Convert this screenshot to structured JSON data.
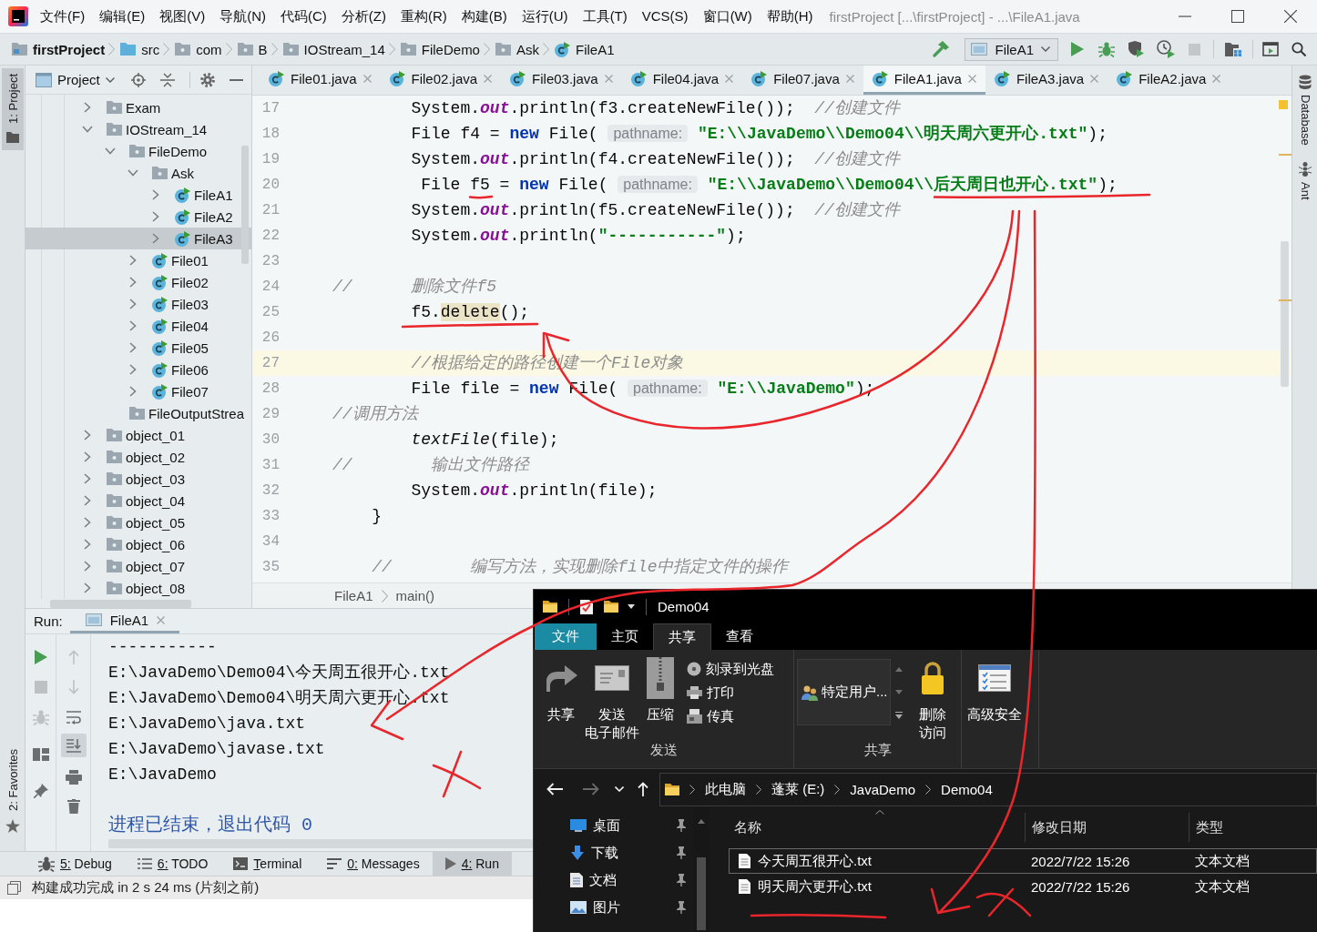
{
  "title_bar": {
    "menus": [
      "文件(F)",
      "编辑(E)",
      "视图(V)",
      "导航(N)",
      "代码(C)",
      "分析(Z)",
      "重构(R)",
      "构建(B)",
      "运行(U)",
      "工具(T)",
      "VCS(S)",
      "窗口(W)",
      "帮助(H)"
    ],
    "title": "firstProject [...\\firstProject] - ...\\FileA1.java"
  },
  "navigation_bar": {
    "breadcrumbs": [
      {
        "label": "firstProject",
        "kind": "project"
      },
      {
        "label": "src",
        "kind": "source"
      },
      {
        "label": "com",
        "kind": "package"
      },
      {
        "label": "B",
        "kind": "package"
      },
      {
        "label": "IOStream_14",
        "kind": "package"
      },
      {
        "label": "FileDemo",
        "kind": "package"
      },
      {
        "label": "Ask",
        "kind": "package"
      },
      {
        "label": "FileA1",
        "kind": "class"
      }
    ],
    "run_config": "FileA1",
    "tools": [
      {
        "disabled": false
      },
      {
        "disabled": false
      },
      {
        "disabled": false
      },
      {
        "disabled": false
      },
      {
        "disabled": true
      }
    ]
  },
  "left_strip": [
    {
      "label": "1: Project",
      "selected": true
    },
    {
      "label": "2: Favorites",
      "selected": false
    }
  ],
  "project_panel": {
    "title": "Project",
    "tree": [
      {
        "label": "Exam",
        "kind": "package",
        "expandable": true,
        "expanded": false,
        "selected": false
      },
      {
        "label": "IOStream_14",
        "kind": "package",
        "expandable": true,
        "expanded": true,
        "selected": false,
        "children": [
          {
            "label": "FileDemo",
            "kind": "package",
            "expandable": true,
            "expanded": true,
            "selected": false,
            "children": [
              {
                "label": "Ask",
                "kind": "package",
                "expandable": true,
                "expanded": true,
                "selected": false,
                "children": [
                  {
                    "label": "FileA1",
                    "kind": "class",
                    "expandable": true,
                    "expanded": false,
                    "selected": false
                  },
                  {
                    "label": "FileA2",
                    "kind": "class",
                    "expandable": true,
                    "expanded": false,
                    "selected": false
                  },
                  {
                    "label": "FileA3",
                    "kind": "class",
                    "expandable": true,
                    "expanded": false,
                    "selected": true
                  }
                ]
              },
              {
                "label": "File01",
                "kind": "class",
                "expandable": true,
                "expanded": false,
                "selected": false
              },
              {
                "label": "File02",
                "kind": "class",
                "expandable": true,
                "expanded": false,
                "selected": false
              },
              {
                "label": "File03",
                "kind": "class",
                "expandable": true,
                "expanded": false,
                "selected": false
              },
              {
                "label": "File04",
                "kind": "class",
                "expandable": true,
                "expanded": false,
                "selected": false
              },
              {
                "label": "File05",
                "kind": "class",
                "expandable": true,
                "expanded": false,
                "selected": false
              },
              {
                "label": "File06",
                "kind": "class",
                "expandable": true,
                "expanded": false,
                "selected": false
              },
              {
                "label": "File07",
                "kind": "class",
                "expandable": true,
                "expanded": false,
                "selected": false
              }
            ]
          },
          {
            "label": "FileOutputStrea",
            "kind": "package",
            "expandable": false,
            "selected": false
          }
        ]
      },
      {
        "label": "object_01",
        "kind": "package",
        "expandable": true,
        "expanded": false,
        "selected": false
      },
      {
        "label": "object_02",
        "kind": "package",
        "expandable": true,
        "expanded": false,
        "selected": false
      },
      {
        "label": "object_03",
        "kind": "package",
        "expandable": true,
        "expanded": false,
        "selected": false
      },
      {
        "label": "object_04",
        "kind": "package",
        "expandable": true,
        "expanded": false,
        "selected": false
      },
      {
        "label": "object_05",
        "kind": "package",
        "expandable": true,
        "expanded": false,
        "selected": false
      },
      {
        "label": "object_06",
        "kind": "package",
        "expandable": true,
        "expanded": false,
        "selected": false
      },
      {
        "label": "object_07",
        "kind": "package",
        "expandable": true,
        "expanded": false,
        "selected": false
      },
      {
        "label": "object_08",
        "kind": "package",
        "expandable": true,
        "expanded": false,
        "selected": false
      }
    ]
  },
  "editor": {
    "tabs": [
      {
        "label": "File01.java",
        "selected": false
      },
      {
        "label": "File02.java",
        "selected": false
      },
      {
        "label": "File03.java",
        "selected": false
      },
      {
        "label": "File04.java",
        "selected": false
      },
      {
        "label": "File07.java",
        "selected": false
      },
      {
        "label": "FileA1.java",
        "selected": true
      },
      {
        "label": "FileA3.java",
        "selected": false
      },
      {
        "label": "FileA2.java",
        "selected": false
      }
    ],
    "lines": [
      {
        "number": "17",
        "current": false,
        "tokens": [
          {
            "kind": "plain",
            "text": "        System."
          },
          {
            "kind": "field",
            "text": "out"
          },
          {
            "kind": "plain",
            "text": ".println(f3.createNewFile());  "
          },
          {
            "kind": "comment",
            "text": "//创建文件"
          }
        ]
      },
      {
        "number": "18",
        "current": false,
        "tokens": [
          {
            "kind": "plain",
            "text": "        File f4 = "
          },
          {
            "kind": "keyword",
            "text": "new"
          },
          {
            "kind": "plain",
            "text": " File( "
          },
          {
            "kind": "hint",
            "text": "pathname:"
          },
          {
            "kind": "string",
            "text": " \"E:\\\\JavaDemo\\\\Demo04\\\\明天周六更开心.txt\""
          },
          {
            "kind": "plain",
            "text": ");"
          }
        ]
      },
      {
        "number": "19",
        "current": false,
        "tokens": [
          {
            "kind": "plain",
            "text": "        System."
          },
          {
            "kind": "field",
            "text": "out"
          },
          {
            "kind": "plain",
            "text": ".println(f4.createNewFile());  "
          },
          {
            "kind": "comment",
            "text": "//创建文件"
          }
        ]
      },
      {
        "number": "20",
        "current": false,
        "tokens": [
          {
            "kind": "plain",
            "text": "         File f5 = "
          },
          {
            "kind": "keyword",
            "text": "new"
          },
          {
            "kind": "plain",
            "text": " File( "
          },
          {
            "kind": "hint",
            "text": "pathname:"
          },
          {
            "kind": "string",
            "text": " \"E:\\\\JavaDemo\\\\Demo04\\\\后天周日也开心.txt\""
          },
          {
            "kind": "plain",
            "text": ");"
          }
        ]
      },
      {
        "number": "21",
        "current": false,
        "tokens": [
          {
            "kind": "plain",
            "text": "        System."
          },
          {
            "kind": "field",
            "text": "out"
          },
          {
            "kind": "plain",
            "text": ".println(f5.createNewFile());  "
          },
          {
            "kind": "comment",
            "text": "//创建文件"
          }
        ]
      },
      {
        "number": "22",
        "current": false,
        "tokens": [
          {
            "kind": "plain",
            "text": "        System."
          },
          {
            "kind": "field",
            "text": "out"
          },
          {
            "kind": "plain",
            "text": ".println("
          },
          {
            "kind": "string",
            "text": "\"-----------\""
          },
          {
            "kind": "plain",
            "text": ");"
          }
        ]
      },
      {
        "number": "23",
        "current": false
      },
      {
        "number": "24",
        "current": false,
        "tokens": [
          {
            "kind": "comment",
            "text": "//      删除文件f5"
          }
        ]
      },
      {
        "number": "25",
        "current": false,
        "tokens": [
          {
            "kind": "plain",
            "text": "        f5."
          },
          {
            "kind": "usage",
            "text": "delete"
          },
          {
            "kind": "plain",
            "text": "();"
          }
        ]
      },
      {
        "number": "26",
        "current": false
      },
      {
        "number": "27",
        "current": true,
        "tokens": [
          {
            "kind": "comment",
            "text": "        //根据给定的路径创建一个File对象"
          }
        ]
      },
      {
        "number": "28",
        "current": false,
        "tokens": [
          {
            "kind": "plain",
            "text": "        File file = "
          },
          {
            "kind": "keyword",
            "text": "new"
          },
          {
            "kind": "plain",
            "text": " File( "
          },
          {
            "kind": "hint",
            "text": "pathname:"
          },
          {
            "kind": "string",
            "text": " \"E:\\\\JavaDemo\""
          },
          {
            "kind": "plain",
            "text": ");"
          }
        ]
      },
      {
        "number": "29",
        "current": false,
        "tokens": [
          {
            "kind": "comment",
            "text": "//调用方法"
          }
        ]
      },
      {
        "number": "30",
        "current": false,
        "tokens": [
          {
            "kind": "static",
            "text": "        textFile"
          },
          {
            "kind": "plain",
            "text": "(file);"
          }
        ]
      },
      {
        "number": "31",
        "current": false,
        "tokens": [
          {
            "kind": "comment",
            "text": "//        输出文件路径"
          }
        ]
      },
      {
        "number": "32",
        "current": false,
        "tokens": [
          {
            "kind": "plain",
            "text": "        System."
          },
          {
            "kind": "field",
            "text": "out"
          },
          {
            "kind": "plain",
            "text": ".println(file);"
          }
        ]
      },
      {
        "number": "33",
        "current": false,
        "tokens": [
          {
            "kind": "plain",
            "text": "    }"
          }
        ]
      },
      {
        "number": "34",
        "current": false
      },
      {
        "number": "35",
        "current": false,
        "tokens": [
          {
            "kind": "comment",
            "text": "    //        编写方法，实现删除file中指定文件的操作"
          }
        ]
      }
    ],
    "breadcrumb": [
      "FileA1",
      "main()"
    ]
  },
  "right_strip": [
    "Database",
    "Ant"
  ],
  "run_panel": {
    "label": "Run:",
    "tabs": [
      {
        "label": "FileA1",
        "selected": true
      }
    ],
    "actions": [
      {
        "disabled": false,
        "on": false
      },
      {
        "disabled": true,
        "on": false
      },
      {
        "disabled": true,
        "on": false
      },
      {
        "disabled": false,
        "on": false
      },
      {
        "disabled": false,
        "on": false
      },
      {
        "disabled": true,
        "on": false
      },
      {
        "disabled": true,
        "on": false
      },
      {
        "disabled": false,
        "on": false
      },
      {
        "disabled": false,
        "on": true
      },
      {
        "disabled": false,
        "on": false
      },
      {
        "disabled": false,
        "on": false
      }
    ],
    "output": [
      {
        "kind": "plain",
        "text": "-----------"
      },
      {
        "kind": "plain",
        "text": "E:\\JavaDemo\\Demo04\\今天周五很开心.txt"
      },
      {
        "kind": "plain",
        "text": "E:\\JavaDemo\\Demo04\\明天周六更开心.txt"
      },
      {
        "kind": "plain",
        "text": "E:\\JavaDemo\\java.txt"
      },
      {
        "kind": "plain",
        "text": "E:\\JavaDemo\\javase.txt"
      },
      {
        "kind": "plain",
        "text": "E:\\JavaDemo"
      },
      {
        "kind": "exit",
        "text": "进程已结束，退出代码 0"
      }
    ]
  },
  "tool_tabs": [
    {
      "label": "5: Debug",
      "selected": false
    },
    {
      "label": "6: TODO",
      "selected": false
    },
    {
      "label": "Terminal",
      "selected": false
    },
    {
      "label": "0: Messages",
      "selected": false
    },
    {
      "label": "4: Run",
      "selected": true
    }
  ],
  "status_bar": {
    "message": "构建成功完成 in 2 s 24 ms (片刻之前)"
  },
  "explorer": {
    "title": "Demo04",
    "ribbon_tabs": [
      {
        "label": "文件",
        "kind": "menu",
        "selected": false
      },
      {
        "label": "主页",
        "kind": "tab",
        "selected": false
      },
      {
        "label": "共享",
        "kind": "tab",
        "selected": true
      },
      {
        "label": "查看",
        "kind": "tab",
        "selected": false
      }
    ],
    "ribbon_groups": [
      {
        "label": "发送",
        "buttons": [
          {
            "lines": [
              "共享"
            ],
            "kind": "large"
          },
          {
            "lines": [
              "发送",
              "电子邮件"
            ],
            "kind": "large"
          },
          {
            "lines": [
              "压缩"
            ],
            "kind": "large"
          },
          {
            "lines": [
              "刻录到光盘"
            ],
            "kind": "small"
          },
          {
            "lines": [
              "打印"
            ],
            "kind": "small"
          },
          {
            "lines": [
              "传真"
            ],
            "kind": "small"
          }
        ]
      },
      {
        "label": "共享",
        "buttons": [
          {
            "lines": [
              "特定用户..."
            ],
            "kind": "gallery"
          },
          {
            "lines": [
              "删除",
              "访问"
            ],
            "kind": "large"
          }
        ]
      },
      {
        "buttons": [
          {
            "lines": [
              "高级安全"
            ],
            "kind": "large"
          }
        ]
      }
    ],
    "nav_buttons": [
      {
        "disabled": false
      },
      {
        "disabled": true
      },
      {
        "disabled": false
      },
      {
        "disabled": false
      }
    ],
    "address": [
      "此电脑",
      "蓬莱 (E:)",
      "JavaDemo",
      "Demo04"
    ],
    "nav_pane": [
      {
        "label": "桌面",
        "pinned": true
      },
      {
        "label": "下载",
        "pinned": true
      },
      {
        "label": "文档",
        "pinned": true
      },
      {
        "label": "图片",
        "pinned": true
      }
    ],
    "columns": [
      "名称",
      "修改日期",
      "类型"
    ],
    "files": [
      {
        "name": "今天周五很开心.txt",
        "modified": "2022/7/22 15:26",
        "type": "文本文档",
        "focused": true
      },
      {
        "name": "明天周六更开心.txt",
        "modified": "2022/7/22 15:26",
        "type": "文本文档",
        "focused": false
      }
    ]
  }
}
